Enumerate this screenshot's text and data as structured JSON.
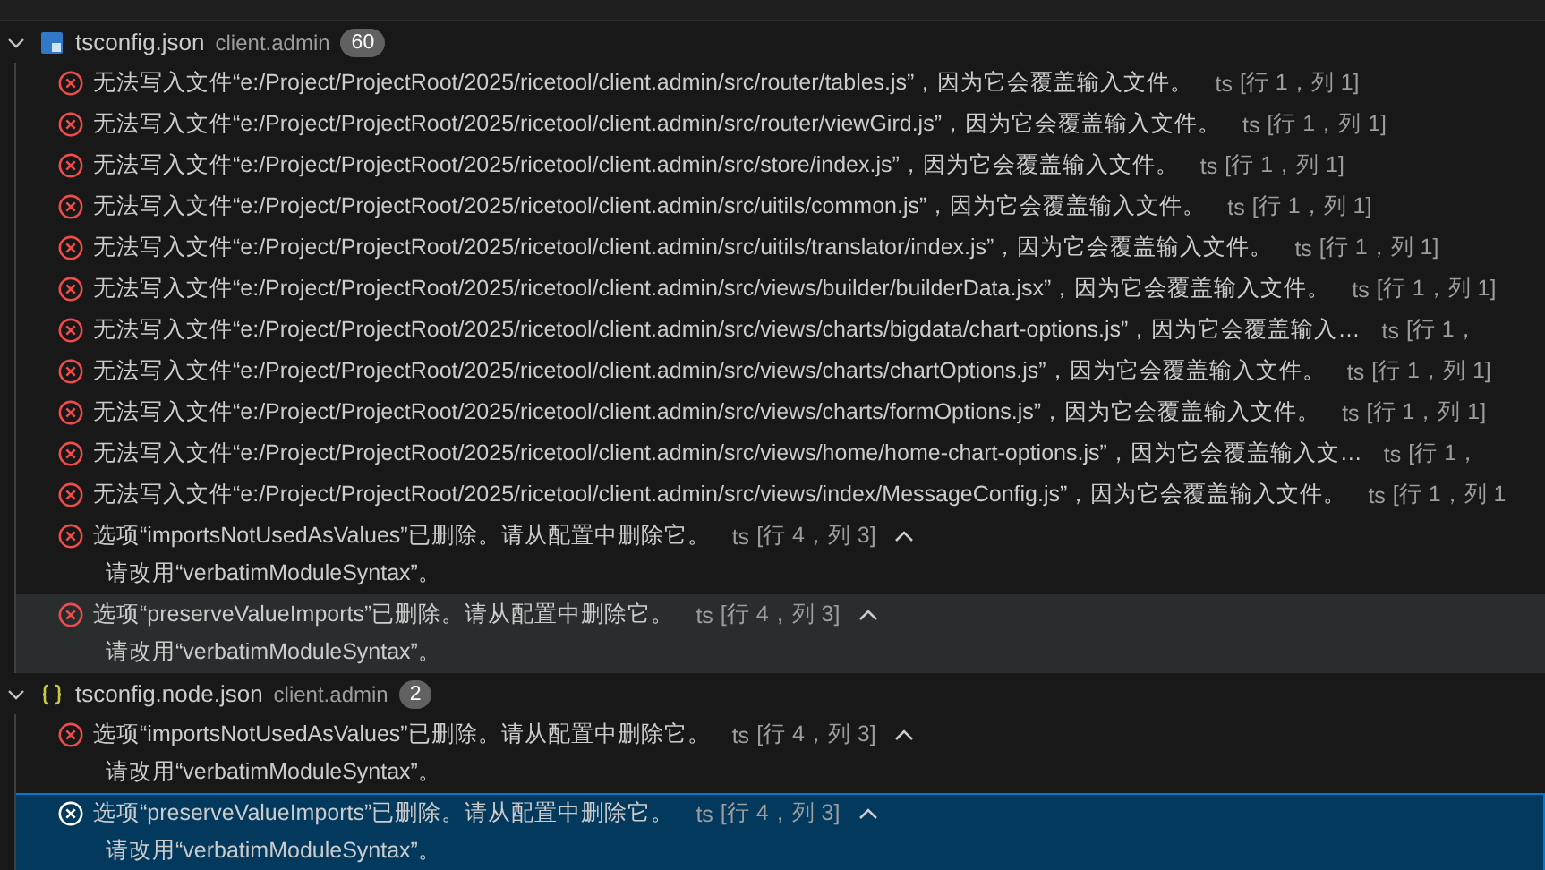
{
  "groups": [
    {
      "file": "tsconfig.json",
      "kind": "ts",
      "folder": "client.admin",
      "count": "60",
      "expanded": true,
      "items": [
        {
          "message": "无法写入文件“e:/Project/ProjectRoot/2025/ricetool/client.admin/src/router/tables.js”，因为它会覆盖输入文件。",
          "source": "ts",
          "location": "[行 1，列 1]",
          "selected": false,
          "hovered": false
        },
        {
          "message": "无法写入文件“e:/Project/ProjectRoot/2025/ricetool/client.admin/src/router/viewGird.js”，因为它会覆盖输入文件。",
          "source": "ts",
          "location": "[行 1，列 1]",
          "selected": false,
          "hovered": false
        },
        {
          "message": "无法写入文件“e:/Project/ProjectRoot/2025/ricetool/client.admin/src/store/index.js”，因为它会覆盖输入文件。",
          "source": "ts",
          "location": "[行 1，列 1]",
          "selected": false,
          "hovered": false
        },
        {
          "message": "无法写入文件“e:/Project/ProjectRoot/2025/ricetool/client.admin/src/uitils/common.js”，因为它会覆盖输入文件。",
          "source": "ts",
          "location": "[行 1，列 1]",
          "selected": false,
          "hovered": false
        },
        {
          "message": "无法写入文件“e:/Project/ProjectRoot/2025/ricetool/client.admin/src/uitils/translator/index.js”，因为它会覆盖输入文件。",
          "source": "ts",
          "location": "[行 1，列 1]",
          "selected": false,
          "hovered": false
        },
        {
          "message": "无法写入文件“e:/Project/ProjectRoot/2025/ricetool/client.admin/src/views/builder/builderData.jsx”，因为它会覆盖输入文件。",
          "source": "ts",
          "location": "[行 1，列 1]",
          "selected": false,
          "hovered": false
        },
        {
          "message": "无法写入文件“e:/Project/ProjectRoot/2025/ricetool/client.admin/src/views/charts/bigdata/chart-options.js”，因为它会覆盖输入…",
          "source": "ts",
          "location": "[行 1，",
          "selected": false,
          "hovered": false
        },
        {
          "message": "无法写入文件“e:/Project/ProjectRoot/2025/ricetool/client.admin/src/views/charts/chartOptions.js”，因为它会覆盖输入文件。",
          "source": "ts",
          "location": "[行 1，列 1]",
          "selected": false,
          "hovered": false
        },
        {
          "message": "无法写入文件“e:/Project/ProjectRoot/2025/ricetool/client.admin/src/views/charts/formOptions.js”，因为它会覆盖输入文件。",
          "source": "ts",
          "location": "[行 1，列 1]",
          "selected": false,
          "hovered": false
        },
        {
          "message": "无法写入文件“e:/Project/ProjectRoot/2025/ricetool/client.admin/src/views/home/home-chart-options.js”，因为它会覆盖输入文…",
          "source": "ts",
          "location": "[行 1，",
          "selected": false,
          "hovered": false
        },
        {
          "message": "无法写入文件“e:/Project/ProjectRoot/2025/ricetool/client.admin/src/views/index/MessageConfig.js”，因为它会覆盖输入文件。",
          "source": "ts",
          "location": "[行 1，列 1",
          "selected": false,
          "hovered": false
        },
        {
          "message": "选项“importsNotUsedAsValues”已删除。请从配置中删除它。",
          "source": "ts",
          "location": "[行 4，列 3]",
          "expanded": true,
          "detail": "请改用“verbatimModuleSyntax”。",
          "selected": false,
          "hovered": false
        },
        {
          "message": "选项“preserveValueImports”已删除。请从配置中删除它。",
          "source": "ts",
          "location": "[行 4，列 3]",
          "expanded": true,
          "detail": "请改用“verbatimModuleSyntax”。",
          "selected": false,
          "hovered": true
        }
      ]
    },
    {
      "file": "tsconfig.node.json",
      "kind": "json",
      "folder": "client.admin",
      "count": "2",
      "expanded": true,
      "items": [
        {
          "message": "选项“importsNotUsedAsValues”已删除。请从配置中删除它。",
          "source": "ts",
          "location": "[行 4，列 3]",
          "expanded": true,
          "detail": "请改用“verbatimModuleSyntax”。",
          "selected": false,
          "hovered": false
        },
        {
          "message": "选项“preserveValueImports”已删除。请从配置中删除它。",
          "source": "ts",
          "location": "[行 4，列 3]",
          "expanded": true,
          "detail": "请改用“verbatimModuleSyntax”。",
          "selected": true,
          "hovered": false
        }
      ]
    }
  ]
}
